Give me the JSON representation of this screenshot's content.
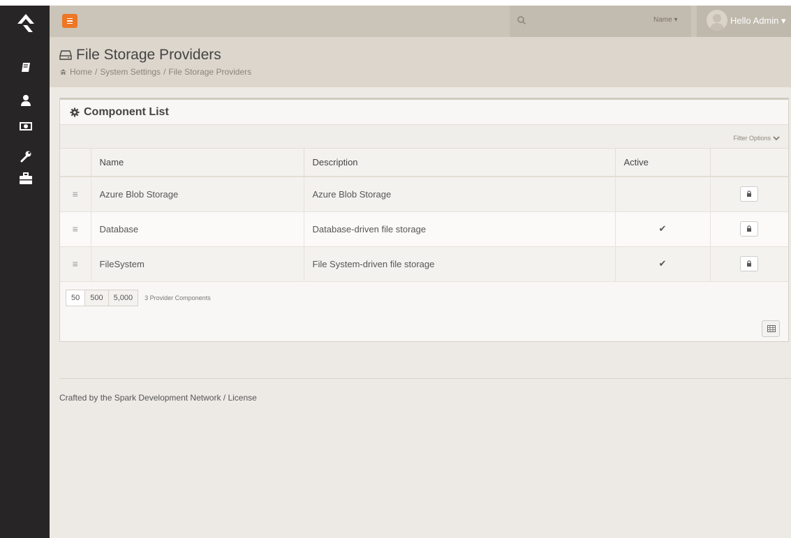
{
  "topbar": {
    "name_filter": "Name",
    "user_greeting": "Hello Admin"
  },
  "page": {
    "title": "File Storage Providers",
    "breadcrumb": [
      "Home",
      "System Settings",
      "File Storage Providers"
    ]
  },
  "panel": {
    "heading": "Component List",
    "filter_options": "Filter Options"
  },
  "grid": {
    "columns": [
      "",
      "Name",
      "Description",
      "Active",
      ""
    ],
    "rows": [
      {
        "name": "Azure Blob Storage",
        "description": "Azure Blob Storage",
        "active": false
      },
      {
        "name": "Database",
        "description": "Database-driven file storage",
        "active": true
      },
      {
        "name": "FileSystem",
        "description": "File System-driven file storage",
        "active": true
      }
    ]
  },
  "pager": {
    "sizes": [
      "50",
      "500",
      "5,000"
    ],
    "count_label": "3 Provider Components"
  },
  "footer": {
    "text": "Crafted by the Spark Development Network / License"
  },
  "colors": {
    "accent": "#ee7625",
    "sidebar": "#282526",
    "topbar": "#cbc4b8"
  }
}
